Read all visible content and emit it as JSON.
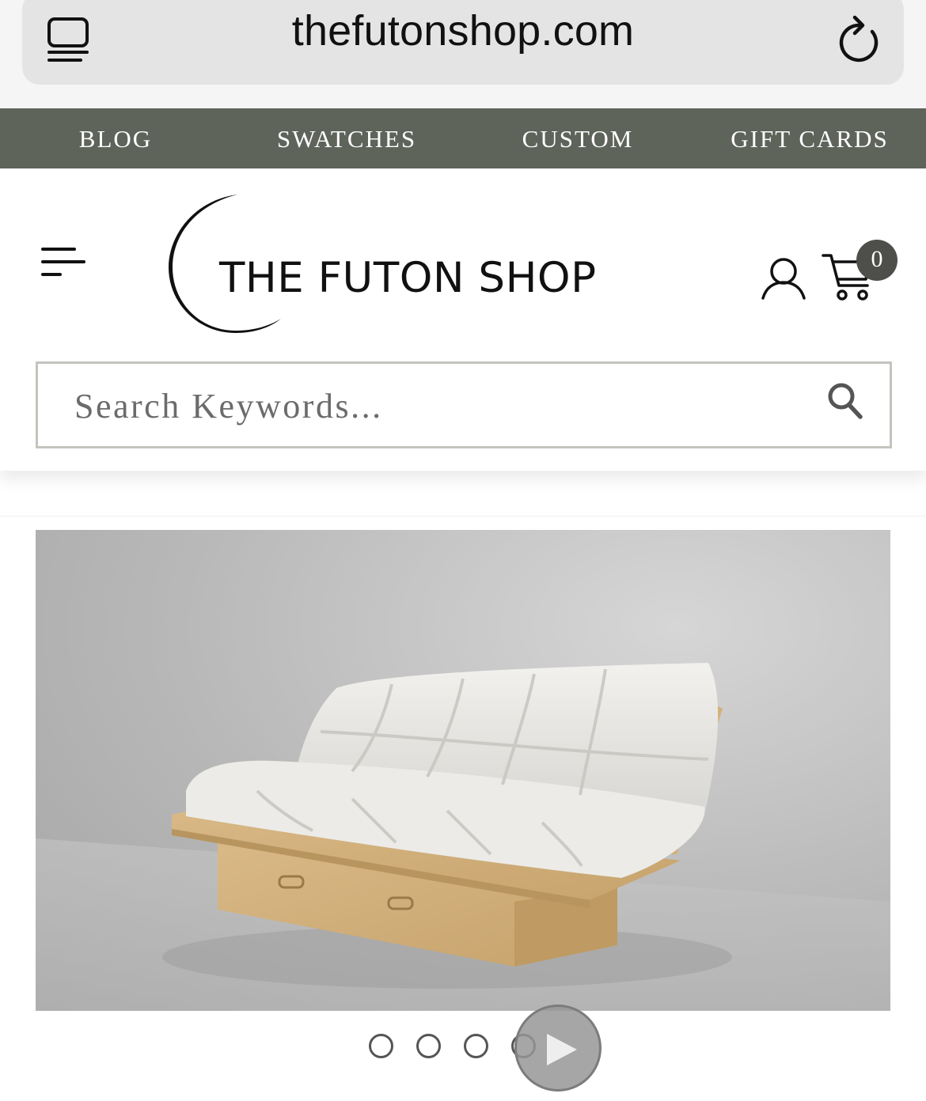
{
  "browser": {
    "url": "thefutonshop.com",
    "tabs_icon": "tabs-icon",
    "reload_icon": "reload-icon"
  },
  "top_nav": {
    "items": [
      {
        "label": "BLOG"
      },
      {
        "label": "SWATCHES"
      },
      {
        "label": "CUSTOM"
      },
      {
        "label": "GIFT CARDS"
      }
    ],
    "background": "#5f645b"
  },
  "header": {
    "menu_icon": "hamburger-menu-icon",
    "logo_text": "THE FUTON SHOP",
    "account_icon": "user-icon",
    "cart_icon": "cart-icon",
    "cart_count": "0"
  },
  "search": {
    "placeholder": "Search Keywords...",
    "value": "",
    "icon": "search-icon"
  },
  "hero": {
    "image": "futon-sofa-product-image"
  },
  "carousel": {
    "slide_count": 4,
    "play_icon": "play-icon"
  }
}
